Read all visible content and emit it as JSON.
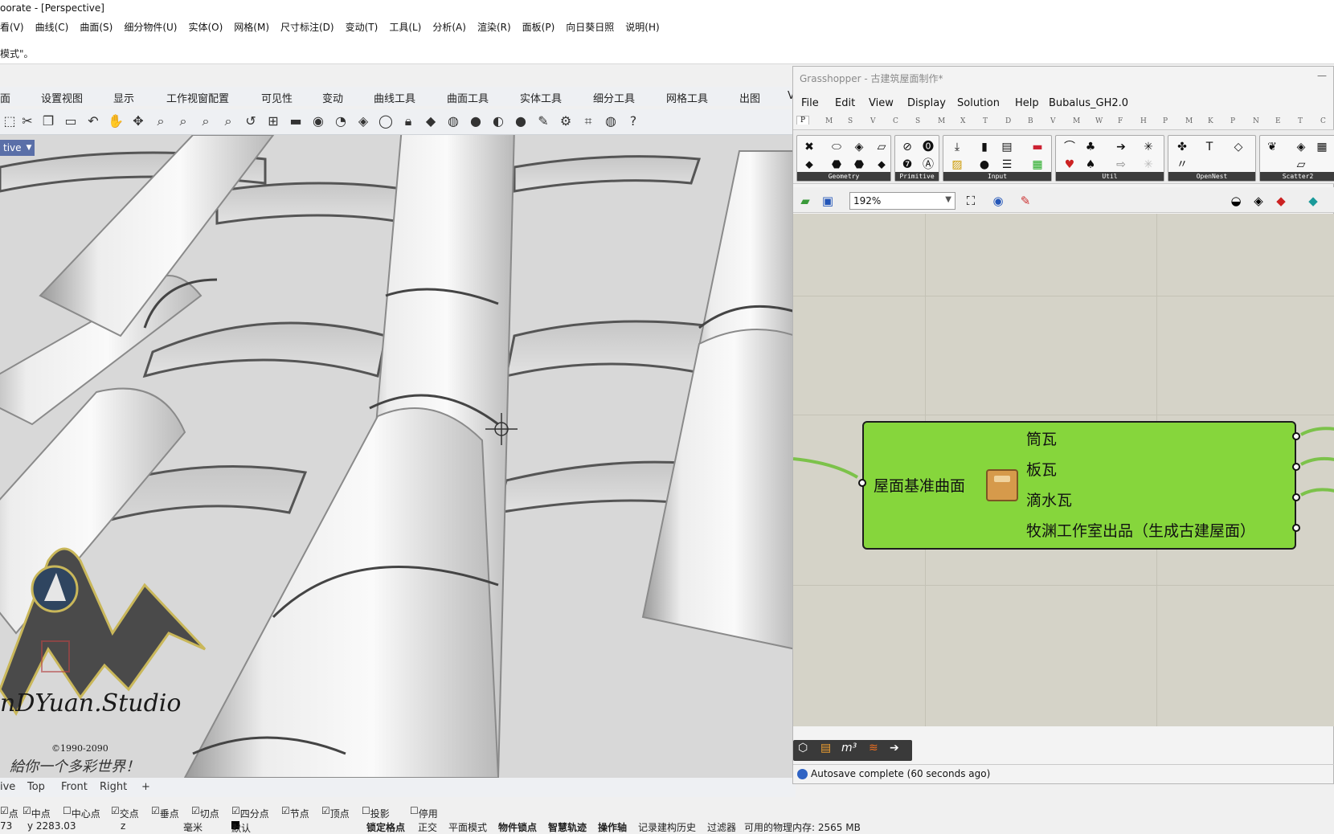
{
  "rhino": {
    "window_title": "oorate - [Perspective]",
    "menu": [
      "看(V)",
      "曲线(C)",
      "曲面(S)",
      "细分物件(U)",
      "实体(O)",
      "网格(M)",
      "尺寸标注(D)",
      "变动(T)",
      "工具(L)",
      "分析(A)",
      "渲染(R)",
      "面板(P)",
      "向日葵日照",
      "说明(H)"
    ],
    "command_prompt": "模式\"。",
    "toolbar_tabs": [
      "面",
      "设置视图",
      "显示",
      "工作视窗配置",
      "可见性",
      "变动",
      "曲线工具",
      "曲面工具",
      "实体工具",
      "细分工具",
      "网格工具",
      "出图",
      "V"
    ],
    "viewport_label": "tive",
    "viewport_tabs": [
      "ive",
      "Top",
      "Front",
      "Right",
      "+"
    ],
    "osnaps": [
      {
        "label": "点",
        "checked": true
      },
      {
        "label": "中点",
        "checked": true
      },
      {
        "label": "中心点",
        "checked": false
      },
      {
        "label": "交点",
        "checked": true
      },
      {
        "label": "垂点",
        "checked": true
      },
      {
        "label": "切点",
        "checked": true
      },
      {
        "label": "四分点",
        "checked": true
      },
      {
        "label": "节点",
        "checked": true
      },
      {
        "label": "顶点",
        "checked": true
      },
      {
        "label": "投影",
        "checked": false
      },
      {
        "label": "停用",
        "checked": false
      }
    ],
    "status": {
      "x": "73",
      "y": "y 2283.03",
      "z": "z",
      "units": "毫米",
      "layer": "默认",
      "lock_grid": "锁定格点",
      "ortho": "正交",
      "planar": "平面模式",
      "osnap": "物件锁点",
      "smarttrack": "智慧轨迹",
      "gumball": "操作轴",
      "history": "记录建构历史",
      "filter": "过滤器",
      "memory": "可用的物理内存: 2565 MB"
    },
    "watermark": {
      "studio": "nDYuan.Studio",
      "years": "©1990-2090",
      "tagline": "給你一个多彩世界！"
    }
  },
  "grasshopper": {
    "window_title": "Grasshopper - 古建筑屋面制作*",
    "minimize": "—",
    "menu": [
      "File",
      "Edit",
      "View",
      "Display",
      "Solution",
      "Help",
      "Bubalus_GH2.0"
    ],
    "component_tabs": [
      "P",
      "M",
      "S",
      "V",
      "C",
      "S",
      "M",
      "X",
      "T",
      "D",
      "B",
      "V",
      "M",
      "W",
      "F",
      "H",
      "P",
      "M",
      "K",
      "P",
      "N",
      "E",
      "T",
      "C"
    ],
    "groups": [
      "Geometry",
      "Primitive",
      "Input",
      "Util",
      "OpenNest",
      "Scatter2"
    ],
    "zoom": "192%",
    "component": {
      "input": "屋面基准曲面",
      "outputs": [
        "筒瓦",
        "板瓦",
        "滴水瓦",
        "牧渊工作室出品（生成古建屋面）"
      ]
    },
    "status": "Autosave complete (60 seconds ago)"
  }
}
